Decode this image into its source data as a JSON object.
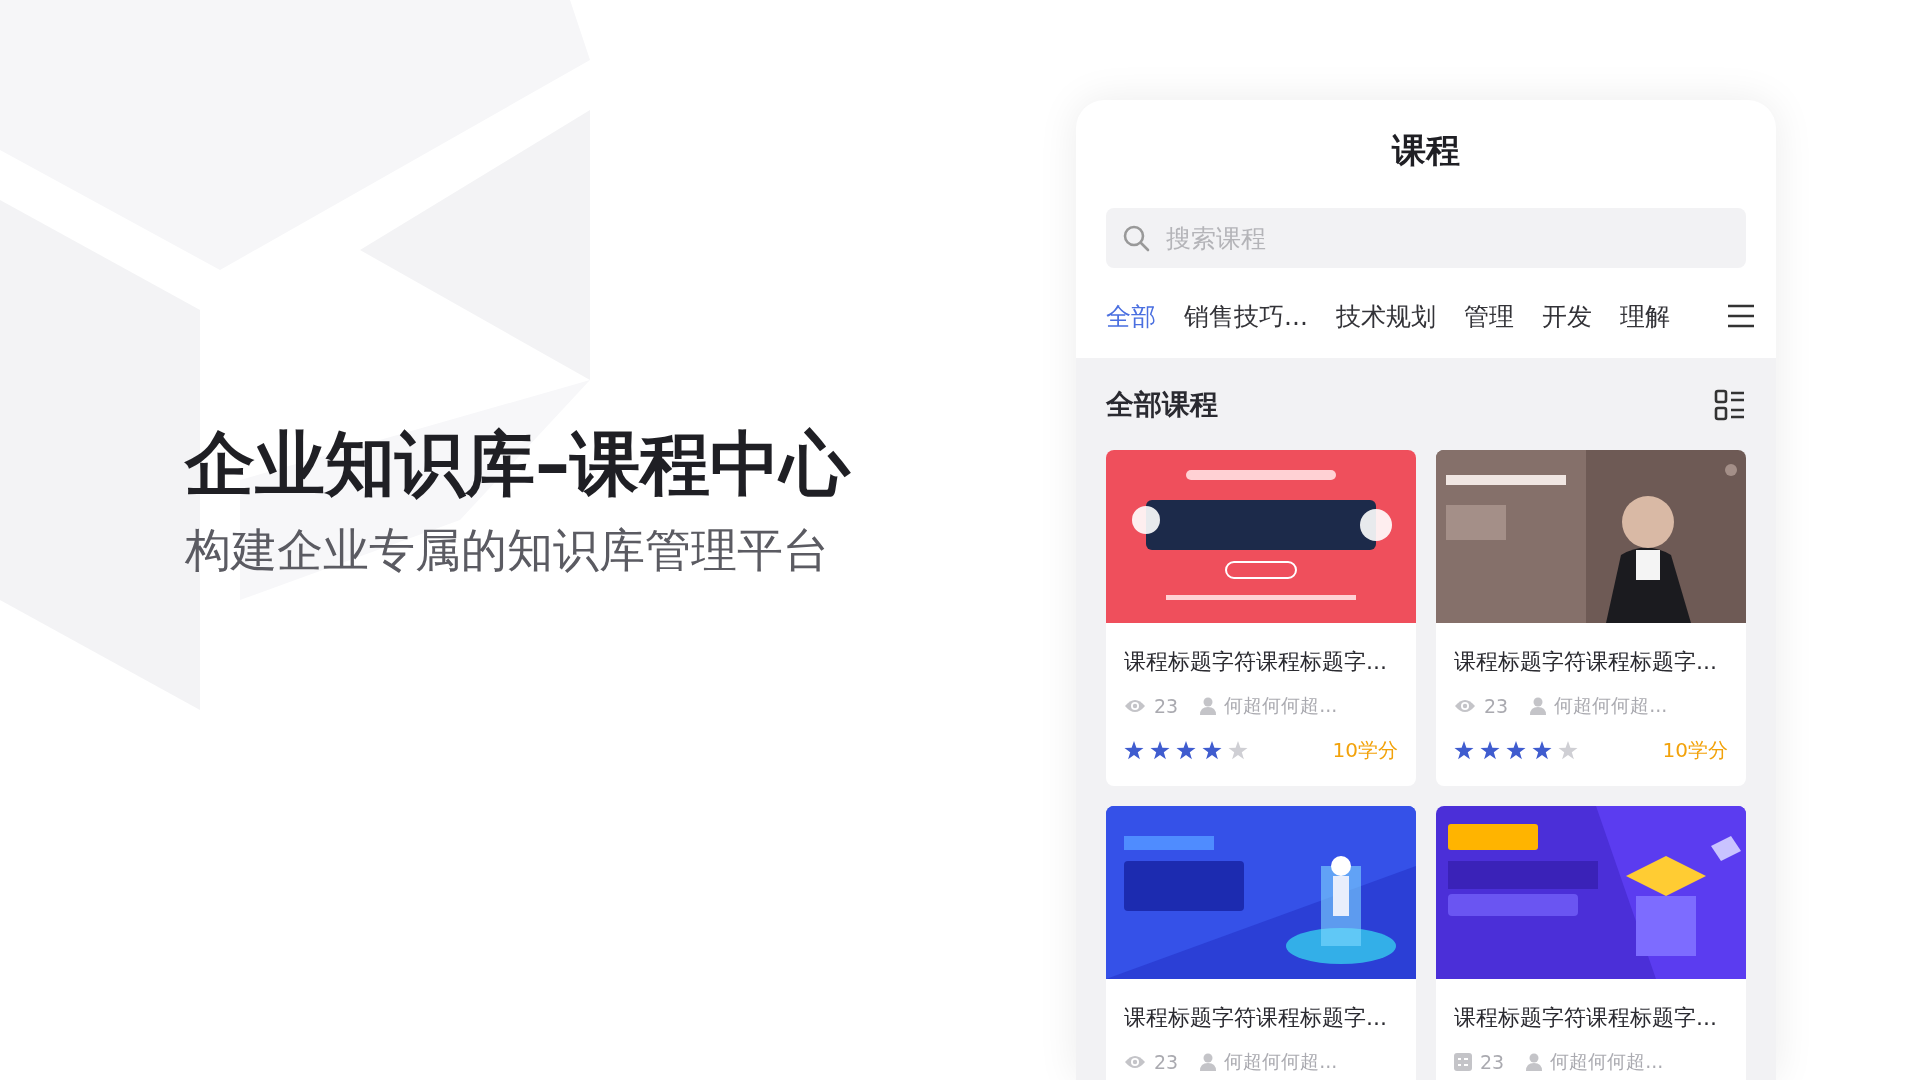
{
  "hero": {
    "title": "企业知识库–课程中心",
    "subtitle": "构建企业专属的知识库管理平台"
  },
  "app": {
    "title": "课程",
    "search": {
      "placeholder": "搜索课程"
    },
    "tabs": [
      {
        "label": "全部",
        "selected": true
      },
      {
        "label": "销售技巧...",
        "selected": false
      },
      {
        "label": "技术规划",
        "selected": false
      },
      {
        "label": "管理",
        "selected": false
      },
      {
        "label": "开发",
        "selected": false
      },
      {
        "label": "理解",
        "selected": false
      }
    ],
    "section_title": "全部课程",
    "courses": [
      {
        "title": "课程标题字符课程标题字...",
        "kind": "views",
        "count": "23",
        "author": "何超何何超...",
        "stars": 4,
        "credits": "10学分"
      },
      {
        "title": "课程标题字符课程标题字...",
        "kind": "views",
        "count": "23",
        "author": "何超何何超...",
        "stars": 4,
        "credits": "10学分"
      },
      {
        "title": "课程标题字符课程标题字...",
        "kind": "views",
        "count": "23",
        "author": "何超何何超..."
      },
      {
        "title": "课程标题字符课程标题字...",
        "kind": "lessons",
        "count": "23",
        "author": "何超何何超..."
      }
    ]
  }
}
